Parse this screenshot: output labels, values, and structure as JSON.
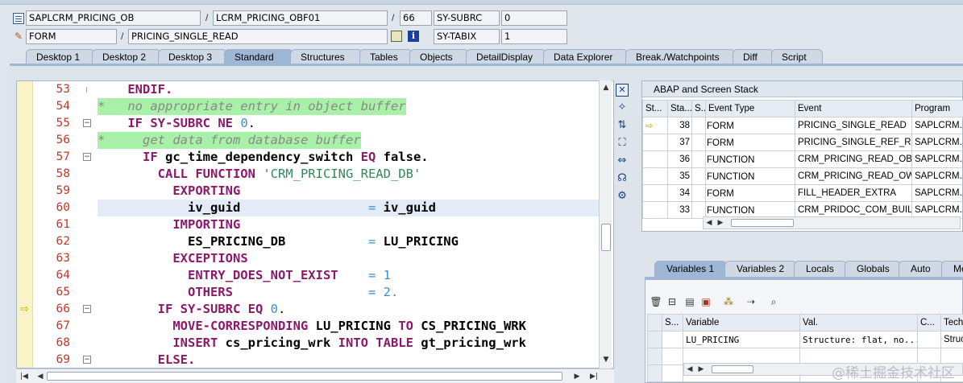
{
  "header": {
    "row1": {
      "program": "SAPLCRM_PRICING_OB",
      "include": "LCRM_PRICING_OBF01",
      "line": "66",
      "sysvar_name": "SY-SUBRC",
      "sysvar_value": "0"
    },
    "row2": {
      "type": "FORM",
      "name": "PRICING_SINGLE_READ",
      "sysvar_name": "SY-TABIX",
      "sysvar_value": "1"
    },
    "separator": "/"
  },
  "tabs": [
    "Desktop 1",
    "Desktop 2",
    "Desktop 3",
    "Standard",
    "Structures",
    "Tables",
    "Objects",
    "DetailDisplay",
    "Data Explorer",
    "Break./Watchpoints",
    "Diff",
    "Script"
  ],
  "active_tab": "Standard",
  "code": {
    "lines": [
      {
        "no": "53",
        "parts": [
          {
            "t": "    ",
            "c": ""
          },
          {
            "t": "ENDIF.",
            "c": "kw"
          }
        ]
      },
      {
        "no": "54",
        "comment": true,
        "parts": [
          {
            "t": "*   no appropriate entry in object buffer",
            "c": "cmt"
          }
        ]
      },
      {
        "no": "55",
        "fold": "−",
        "parts": [
          {
            "t": "    ",
            "c": ""
          },
          {
            "t": "IF ",
            "c": "kw"
          },
          {
            "t": "SY-SUBRC ",
            "c": "kw"
          },
          {
            "t": "NE ",
            "c": "kw"
          },
          {
            "t": "0",
            "c": "num"
          },
          {
            "t": ".",
            "c": ""
          }
        ]
      },
      {
        "no": "56",
        "comment": true,
        "parts": [
          {
            "t": "*     get data from database buffer",
            "c": "cmt"
          }
        ]
      },
      {
        "no": "57",
        "fold": "−",
        "parts": [
          {
            "t": "      ",
            "c": ""
          },
          {
            "t": "IF ",
            "c": "kw"
          },
          {
            "t": "gc_time_dependency_switch ",
            "c": "idb"
          },
          {
            "t": "EQ ",
            "c": "kw"
          },
          {
            "t": "false.",
            "c": "idb"
          }
        ]
      },
      {
        "no": "58",
        "parts": [
          {
            "t": "        ",
            "c": ""
          },
          {
            "t": "CALL FUNCTION ",
            "c": "kw"
          },
          {
            "t": "'CRM_PRICING_READ_DB'",
            "c": "str"
          }
        ]
      },
      {
        "no": "59",
        "parts": [
          {
            "t": "          ",
            "c": ""
          },
          {
            "t": "EXPORTING",
            "c": "kw"
          }
        ]
      },
      {
        "no": "60",
        "current": true,
        "parts": [
          {
            "t": "            ",
            "c": ""
          },
          {
            "t": "iv_guid",
            "c": "idb"
          },
          {
            "t": "                 ",
            "c": ""
          },
          {
            "t": "=",
            "c": "op"
          },
          {
            "t": " iv_guid",
            "c": "idb"
          }
        ]
      },
      {
        "no": "61",
        "parts": [
          {
            "t": "          ",
            "c": ""
          },
          {
            "t": "IMPORTING",
            "c": "kw"
          }
        ]
      },
      {
        "no": "62",
        "parts": [
          {
            "t": "            ",
            "c": ""
          },
          {
            "t": "ES_PRICING_DB",
            "c": "idb"
          },
          {
            "t": "           ",
            "c": ""
          },
          {
            "t": "=",
            "c": "op"
          },
          {
            "t": " LU_PRICING",
            "c": "idb"
          }
        ]
      },
      {
        "no": "63",
        "parts": [
          {
            "t": "          ",
            "c": ""
          },
          {
            "t": "EXCEPTIONS",
            "c": "kw"
          }
        ]
      },
      {
        "no": "64",
        "parts": [
          {
            "t": "            ",
            "c": ""
          },
          {
            "t": "ENTRY_DOES_NOT_EXIST",
            "c": "kw"
          },
          {
            "t": "    ",
            "c": ""
          },
          {
            "t": "=",
            "c": "op"
          },
          {
            "t": " 1",
            "c": "num"
          }
        ]
      },
      {
        "no": "65",
        "parts": [
          {
            "t": "            ",
            "c": ""
          },
          {
            "t": "OTHERS",
            "c": "kw"
          },
          {
            "t": "                  ",
            "c": ""
          },
          {
            "t": "=",
            "c": "op"
          },
          {
            "t": " 2.",
            "c": "num"
          }
        ]
      },
      {
        "no": "66",
        "fold": "−",
        "arrow": true,
        "parts": [
          {
            "t": "        ",
            "c": ""
          },
          {
            "t": "IF ",
            "c": "kw"
          },
          {
            "t": "SY-SUBRC ",
            "c": "kw"
          },
          {
            "t": "EQ ",
            "c": "kw"
          },
          {
            "t": "0",
            "c": "num"
          },
          {
            "t": ".",
            "c": ""
          }
        ]
      },
      {
        "no": "67",
        "parts": [
          {
            "t": "          ",
            "c": ""
          },
          {
            "t": "MOVE-CORRESPONDING ",
            "c": "kw"
          },
          {
            "t": "LU_PRICING ",
            "c": "idb"
          },
          {
            "t": "TO ",
            "c": "kw"
          },
          {
            "t": "CS_PRICING_WRK",
            "c": "idb"
          }
        ]
      },
      {
        "no": "68",
        "parts": [
          {
            "t": "          ",
            "c": ""
          },
          {
            "t": "INSERT ",
            "c": "kw"
          },
          {
            "t": "cs_pricing_wrk ",
            "c": "idb"
          },
          {
            "t": "INTO TABLE ",
            "c": "kw"
          },
          {
            "t": "gt_pricing_wrk",
            "c": "idb"
          }
        ]
      },
      {
        "no": "69",
        "fold": "−",
        "parts": [
          {
            "t": "        ",
            "c": ""
          },
          {
            "t": "ELSE.",
            "c": "kw"
          }
        ]
      }
    ]
  },
  "stack": {
    "title": "ABAP and Screen Stack",
    "columns": [
      "St...",
      "Sta...",
      "S...",
      "Event Type",
      "Event",
      "Program"
    ],
    "rows": [
      {
        "current": true,
        "level": "38",
        "type": "FORM",
        "event": "PRICING_SINGLE_READ",
        "program": "SAPLCRM..."
      },
      {
        "current": false,
        "level": "37",
        "type": "FORM",
        "event": "PRICING_SINGLE_REF_R...",
        "program": "SAPLCRM..."
      },
      {
        "current": false,
        "level": "36",
        "type": "FUNCTION",
        "event": "CRM_PRICING_READ_OB",
        "program": "SAPLCRM..."
      },
      {
        "current": false,
        "level": "35",
        "type": "FUNCTION",
        "event": "CRM_PRICING_READ_OW",
        "program": "SAPLCRM..."
      },
      {
        "current": false,
        "level": "34",
        "type": "FORM",
        "event": "FILL_HEADER_EXTRA",
        "program": "SAPLCRM..."
      },
      {
        "current": false,
        "level": "33",
        "type": "FUNCTION",
        "event": "CRM_PRIDOC_COM_BUIL...",
        "program": "SAPLCRM..."
      }
    ]
  },
  "variables": {
    "tabs": [
      "Variables 1",
      "Variables 2",
      "Locals",
      "Globals",
      "Auto",
      "Me"
    ],
    "active_tab": "Variables 1",
    "columns": [
      "S...",
      "Variable",
      "Val.",
      "C...",
      "Tech"
    ],
    "rows": [
      {
        "variable": "LU_PRICING",
        "value": "Structure: flat, no...",
        "tech": "Struc"
      }
    ]
  },
  "watermark": "@稀土掘金技术社区"
}
